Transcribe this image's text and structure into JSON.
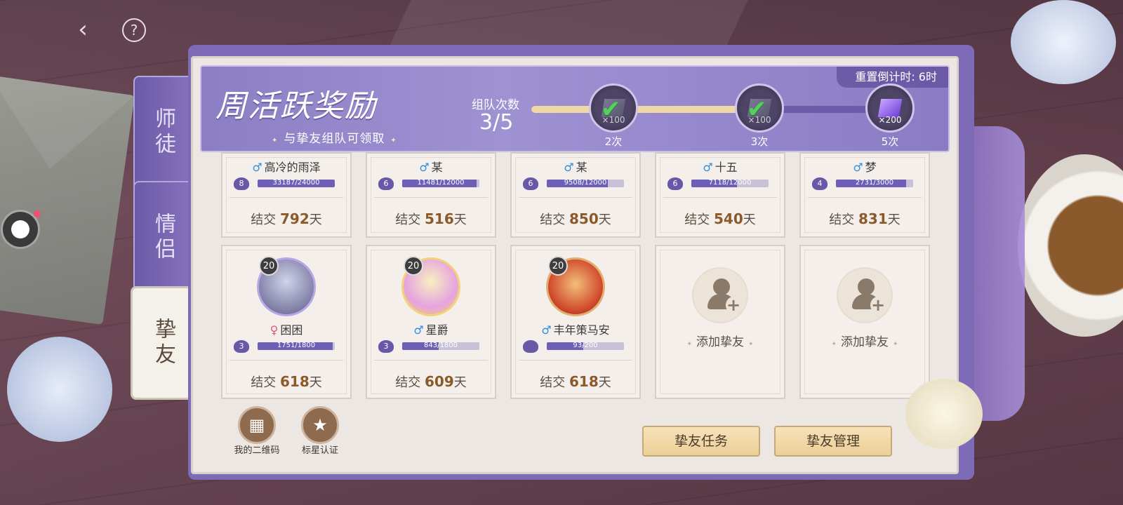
{
  "nav": {
    "back_icon": "back-arrow-icon",
    "help_icon": "question-mark-icon",
    "help_glyph": "?"
  },
  "tabs": [
    {
      "label": "师徒",
      "active": false
    },
    {
      "label": "情侣",
      "active": false
    },
    {
      "label": "挚友",
      "active": true
    }
  ],
  "header": {
    "title": "周活跃奖励",
    "subtitle": "与挚友组队可领取",
    "reset_timer": "重置倒计时: 6时",
    "team_label": "组队次数",
    "team_count": "3/5",
    "progress_fraction": 0.6,
    "milestones": [
      {
        "qty": "×100",
        "label": "2次",
        "claimed": true,
        "icon": "silver-gem-icon"
      },
      {
        "qty": "×100",
        "label": "3次",
        "claimed": true,
        "icon": "silver-gem-icon"
      },
      {
        "qty": "×200",
        "label": "5次",
        "claimed": false,
        "icon": "purple-gem-icon"
      }
    ]
  },
  "friends_row1": [
    {
      "name": "高冷的雨泽",
      "gender": "♂",
      "level_badge": "8",
      "exp_text": "33187/24000",
      "exp_fraction": 1.0,
      "days_prefix": "结交",
      "days": "792",
      "days_suffix": "天"
    },
    {
      "name": "某",
      "gender": "♂",
      "level_badge": "6",
      "exp_text": "11481/12000",
      "exp_fraction": 0.96,
      "days_prefix": "结交",
      "days": "516",
      "days_suffix": "天"
    },
    {
      "name": "某",
      "gender": "♂",
      "level_badge": "6",
      "exp_text": "9508/12000",
      "exp_fraction": 0.79,
      "days_prefix": "结交",
      "days": "850",
      "days_suffix": "天"
    },
    {
      "name": "十五",
      "gender": "♂",
      "level_badge": "6",
      "exp_text": "7118/12000",
      "exp_fraction": 0.59,
      "days_prefix": "结交",
      "days": "540",
      "days_suffix": "天"
    },
    {
      "name": "梦",
      "gender": "♂",
      "level_badge": "4",
      "exp_text": "2731/3000",
      "exp_fraction": 0.91,
      "days_prefix": "结交",
      "days": "831",
      "days_suffix": "天"
    }
  ],
  "friends_row2": [
    {
      "name": "困困",
      "gender": "♀",
      "level": "20",
      "level_badge": "3",
      "exp_text": "1751/1800",
      "exp_fraction": 0.97,
      "days_prefix": "结交",
      "days": "618",
      "days_suffix": "天",
      "avatar_colors": [
        "#5e5a8a",
        "#cfd4e8"
      ]
    },
    {
      "name": "星爵",
      "gender": "♂",
      "level": "20",
      "level_badge": "3",
      "exp_text": "843/1800",
      "exp_fraction": 0.47,
      "days_prefix": "结交",
      "days": "609",
      "days_suffix": "天",
      "avatar_colors": [
        "#f4d35e",
        "#e6a3e0"
      ]
    },
    {
      "name": "丰年策马安",
      "gender": "♂",
      "level": "20",
      "level_badge": "",
      "exp_text": "93/200",
      "exp_fraction": 0.47,
      "days_prefix": "结交",
      "days": "618",
      "days_suffix": "天",
      "avatar_colors": [
        "#d14a2c",
        "#f2c07a"
      ]
    }
  ],
  "add_slots": [
    {
      "label": "添加挚友"
    },
    {
      "label": "添加挚友"
    }
  ],
  "bottom": {
    "qr_label": "我的二维码",
    "qr_glyph": "▦",
    "star_label": "标星认证",
    "star_glyph": "★",
    "task_button": "挚友任务",
    "manage_button": "挚友管理"
  },
  "colors": {
    "accent": "#8c7ec4",
    "days_number": "#8b5a2b",
    "check": "#54d35a",
    "male": "#2c8fe0",
    "female": "#e05a78"
  }
}
